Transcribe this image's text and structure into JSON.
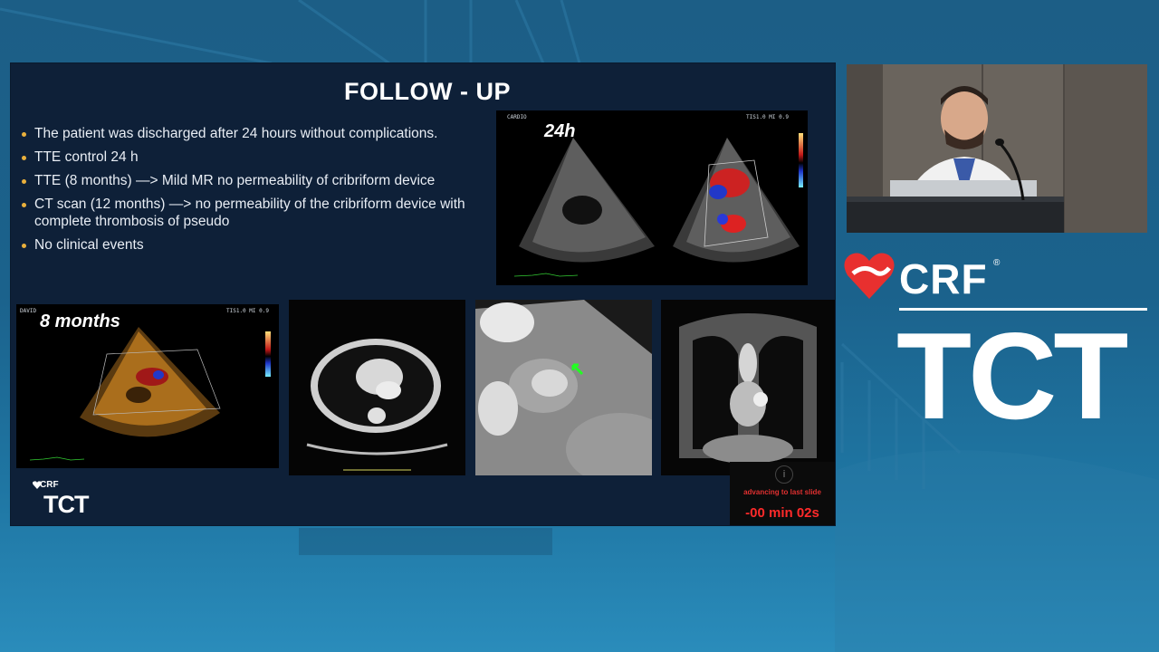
{
  "slide": {
    "title": "FOLLOW - UP",
    "bullets": [
      "The patient was discharged after 24 hours without complications.",
      "TTE control 24 h",
      "TTE (8 months) —> Mild MR no permeability of cribriform device",
      "CT scan (12 months) —> no permeability of the cribriform device with complete thrombosis of pseudo",
      "No clinical events"
    ],
    "echo24": {
      "label": "24h",
      "tag_left": "CARDIO",
      "tag_right": "TIS1.0   MI 0.9"
    },
    "echo8": {
      "label": "8 months",
      "tag_left": "DAVID",
      "tag_right": "TIS1.0   MI 0.9"
    },
    "footer_logo": {
      "crf": "CRF",
      "tct": "TCT"
    },
    "advance": {
      "info": "i",
      "text": "advancing to last slide",
      "countdown": "-00 min 02s"
    }
  },
  "brand": {
    "crf": "CRF",
    "registered": "®",
    "tct": "TCT"
  },
  "colors": {
    "slide_bg": "#0e2038",
    "bullet": "#e9b03c",
    "countdown": "#ff2a2a",
    "brand_red": "#e8302f"
  }
}
